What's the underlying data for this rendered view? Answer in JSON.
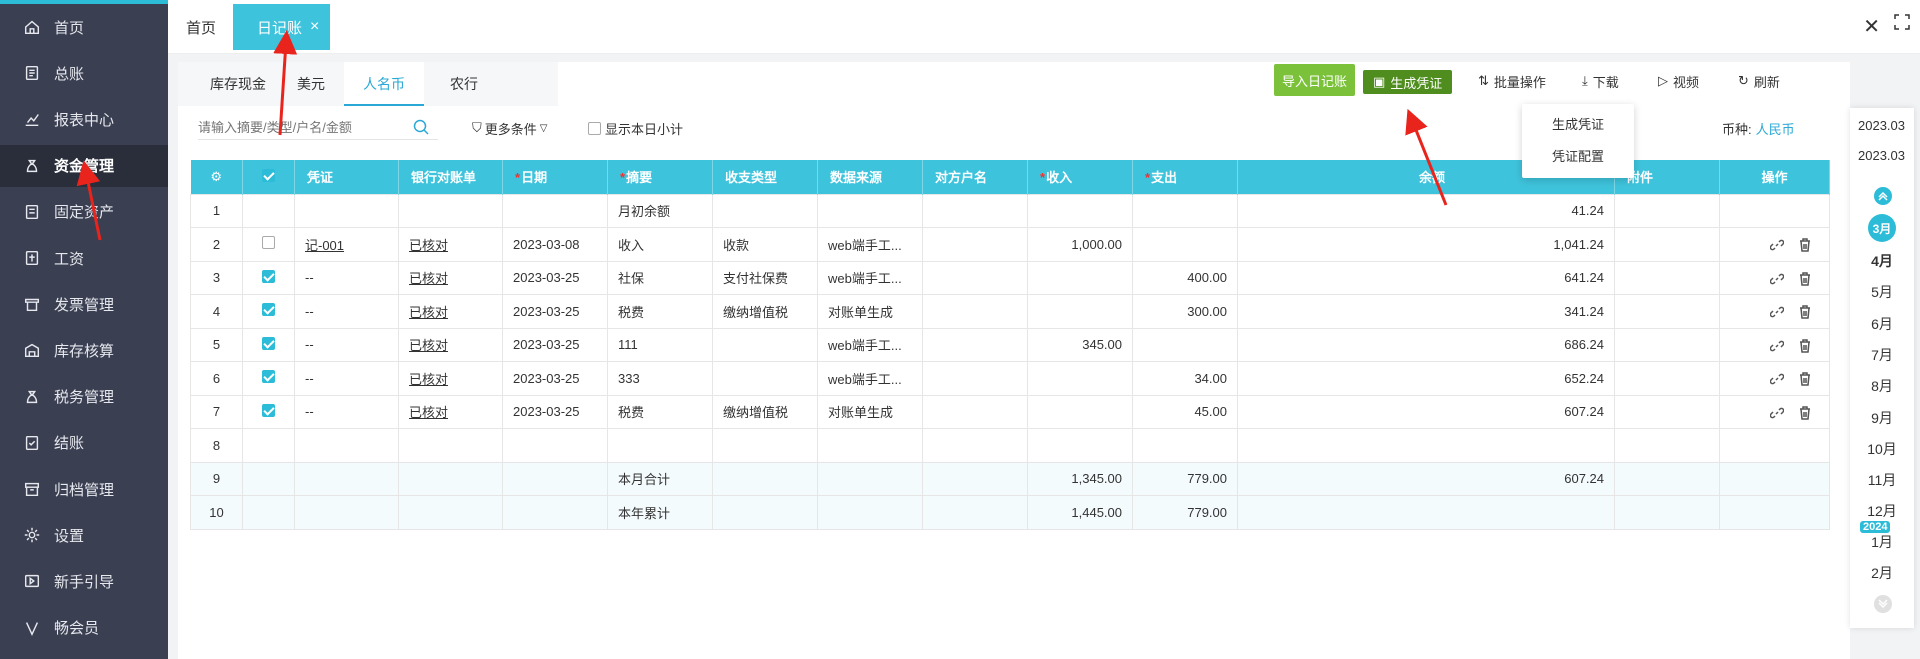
{
  "sidebar": {
    "items": [
      {
        "label": "首页",
        "icon": "home-icon"
      },
      {
        "label": "总账",
        "icon": "ledger-icon"
      },
      {
        "label": "报表中心",
        "icon": "chart-icon"
      },
      {
        "label": "资金管理",
        "icon": "money-bag-icon"
      },
      {
        "label": "固定资产",
        "icon": "asset-icon"
      },
      {
        "label": "工资",
        "icon": "salary-icon"
      },
      {
        "label": "发票管理",
        "icon": "invoice-icon"
      },
      {
        "label": "库存核算",
        "icon": "warehouse-icon"
      },
      {
        "label": "税务管理",
        "icon": "tax-icon"
      },
      {
        "label": "结账",
        "icon": "checkout-icon"
      },
      {
        "label": "归档管理",
        "icon": "archive-icon"
      },
      {
        "label": "设置",
        "icon": "gear-icon"
      },
      {
        "label": "新手引导",
        "icon": "guide-icon"
      },
      {
        "label": "畅会员",
        "icon": "vip-icon"
      }
    ],
    "active_index": 3
  },
  "tabs": {
    "home": "首页",
    "active": "日记账",
    "close": "×"
  },
  "subtabs": [
    "库存现金",
    "美元",
    "人名币",
    "农行"
  ],
  "toolbar": {
    "import": "导入日记账",
    "generate": "生成凭证",
    "batch": "批量操作",
    "download": "下载",
    "video": "视频",
    "refresh": "刷新"
  },
  "dropdown": {
    "items": [
      "生成凭证",
      "凭证配置"
    ]
  },
  "filters": {
    "search_placeholder": "请输入摘要/类型/户名/金额",
    "more": "更多条件",
    "show_daily": "显示本日小计",
    "currency_label": "币种:",
    "currency_value": "人民币"
  },
  "table": {
    "headers": [
      "凭证",
      "银行对账单",
      "日期",
      "摘要",
      "收支类型",
      "数据来源",
      "对方户名",
      "收入",
      "支出",
      "余额",
      "附件",
      "操作"
    ],
    "rows": [
      {
        "no": "1",
        "check": null,
        "voucher": "",
        "bank": "",
        "date": "",
        "summary": "月初余额",
        "type": "",
        "source": "",
        "party": "",
        "income": "",
        "expense": "",
        "balance": "41.24",
        "ops": false,
        "sum": false
      },
      {
        "no": "2",
        "check": false,
        "voucher": "记-001",
        "bank": "已核对",
        "date": "2023-03-08",
        "summary": "收入",
        "type": "收款",
        "source": "web端手工...",
        "party": "",
        "income": "1,000.00",
        "expense": "",
        "balance": "1,041.24",
        "ops": true,
        "sum": false
      },
      {
        "no": "3",
        "check": true,
        "voucher": "--",
        "bank": "已核对",
        "date": "2023-03-25",
        "summary": "社保",
        "type": "支付社保费",
        "source": "web端手工...",
        "party": "",
        "income": "",
        "expense": "400.00",
        "balance": "641.24",
        "ops": true,
        "sum": false
      },
      {
        "no": "4",
        "check": true,
        "voucher": "--",
        "bank": "已核对",
        "date": "2023-03-25",
        "summary": "税费",
        "type": "缴纳增值税",
        "source": "对账单生成",
        "party": "",
        "income": "",
        "expense": "300.00",
        "balance": "341.24",
        "ops": true,
        "sum": false
      },
      {
        "no": "5",
        "check": true,
        "voucher": "--",
        "bank": "已核对",
        "date": "2023-03-25",
        "summary": "111",
        "type": "",
        "source": "web端手工...",
        "party": "",
        "income": "345.00",
        "expense": "",
        "balance": "686.24",
        "ops": true,
        "sum": false
      },
      {
        "no": "6",
        "check": true,
        "voucher": "--",
        "bank": "已核对",
        "date": "2023-03-25",
        "summary": "333",
        "type": "",
        "source": "web端手工...",
        "party": "",
        "income": "",
        "expense": "34.00",
        "balance": "652.24",
        "ops": true,
        "sum": false
      },
      {
        "no": "7",
        "check": true,
        "voucher": "--",
        "bank": "已核对",
        "date": "2023-03-25",
        "summary": "税费",
        "type": "缴纳增值税",
        "source": "对账单生成",
        "party": "",
        "income": "",
        "expense": "45.00",
        "balance": "607.24",
        "ops": true,
        "sum": false
      },
      {
        "no": "8",
        "check": null,
        "voucher": "",
        "bank": "",
        "date": "",
        "summary": "",
        "type": "",
        "source": "",
        "party": "",
        "income": "",
        "expense": "",
        "balance": "",
        "ops": false,
        "sum": false
      },
      {
        "no": "9",
        "check": null,
        "voucher": "",
        "bank": "",
        "date": "",
        "summary": "本月合计",
        "type": "",
        "source": "",
        "party": "",
        "income": "1,345.00",
        "expense": "779.00",
        "balance": "607.24",
        "ops": false,
        "sum": true
      },
      {
        "no": "10",
        "check": null,
        "voucher": "",
        "bank": "",
        "date": "",
        "summary": "本年累计",
        "type": "",
        "source": "",
        "party": "",
        "income": "1,445.00",
        "expense": "779.00",
        "balance": "",
        "ops": false,
        "sum": true
      }
    ]
  },
  "month_panel": {
    "years": [
      "2023.03",
      "2023.03"
    ],
    "current": "3月",
    "months_2023": [
      "4月",
      "5月",
      "6月",
      "7月",
      "8月",
      "9月",
      "10月",
      "11月",
      "12月"
    ],
    "year_badge": "2024",
    "months_2024": [
      "1月",
      "2月"
    ]
  },
  "colors": {
    "sidebar_bg": "#3a3f51",
    "accent": "#3ec3dc",
    "green": "#7bc23a",
    "dark_green": "#4f8e1e",
    "link_blue": "#2aa8d6",
    "annotation_red": "#e8241d"
  }
}
